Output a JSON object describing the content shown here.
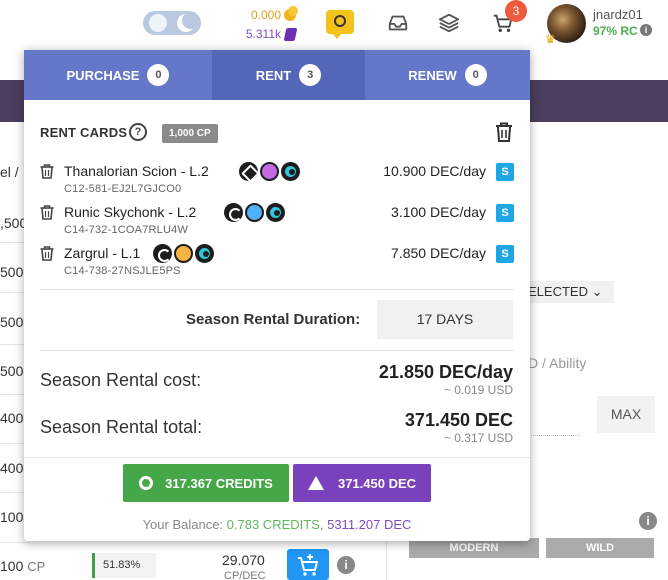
{
  "header": {
    "dc_balance": "0.000",
    "dec_balance": "5.311k",
    "cart_count": "3",
    "username": "jnardz01",
    "rc": "97% RC",
    "rc_info": "i"
  },
  "background": {
    "left_rows": [
      {
        "text": "el /"
      },
      {
        "text": ",500"
      },
      {
        "text": "500"
      },
      {
        "text": "500"
      },
      {
        "text": "500"
      },
      {
        "text": "400"
      },
      {
        "text": "400"
      },
      {
        "text": "100"
      },
      {
        "text": "100"
      },
      {
        "text": "100",
        "unit": "CP"
      }
    ],
    "selected_dropdown": "ELECTED",
    "ability_text": "D / Ability",
    "max_label": "MAX",
    "info_label": "i",
    "format_modern": "MODERN",
    "format_wild": "WILD",
    "row_pct": "51.83%",
    "row_price": "29.070",
    "row_price_unit": "CP/DEC"
  },
  "modal": {
    "tabs": [
      {
        "label": "PURCHASE",
        "count": "0"
      },
      {
        "label": "RENT",
        "count": "3"
      },
      {
        "label": "RENEW",
        "count": "0"
      }
    ],
    "title": "RENT CARDS",
    "help": "?",
    "cp_badge": "1,000 CP",
    "cards": [
      {
        "name": "Thanalorian Scion - L.2",
        "uid": "C12-581-EJ2L7GJCO0",
        "rate": "10.900 DEC/day",
        "badge": "S"
      },
      {
        "name": "Runic Skychonk - L.2",
        "uid": "C14-732-1COA7RLU4W",
        "rate": "3.100 DEC/day",
        "badge": "S"
      },
      {
        "name": "Zargrul - L.1",
        "uid": "C14-738-27NSJLE5PS",
        "rate": "7.850 DEC/day",
        "badge": "S"
      }
    ],
    "duration_label": "Season Rental Duration:",
    "duration_value": "17 DAYS",
    "cost_label": "Season Rental cost:",
    "cost_value": "21.850 DEC/day",
    "cost_usd": "~ 0.019 USD",
    "total_label": "Season Rental total:",
    "total_value": "371.450 DEC",
    "total_usd": "~ 0.317 USD",
    "pay_credits": "317.367 CREDITS",
    "pay_dec": "371.450 DEC",
    "balance_prefix": "Your Balance: ",
    "balance_credits": "0.783 CREDITS",
    "balance_sep": ", ",
    "balance_dec": "5311.207 DEC"
  }
}
